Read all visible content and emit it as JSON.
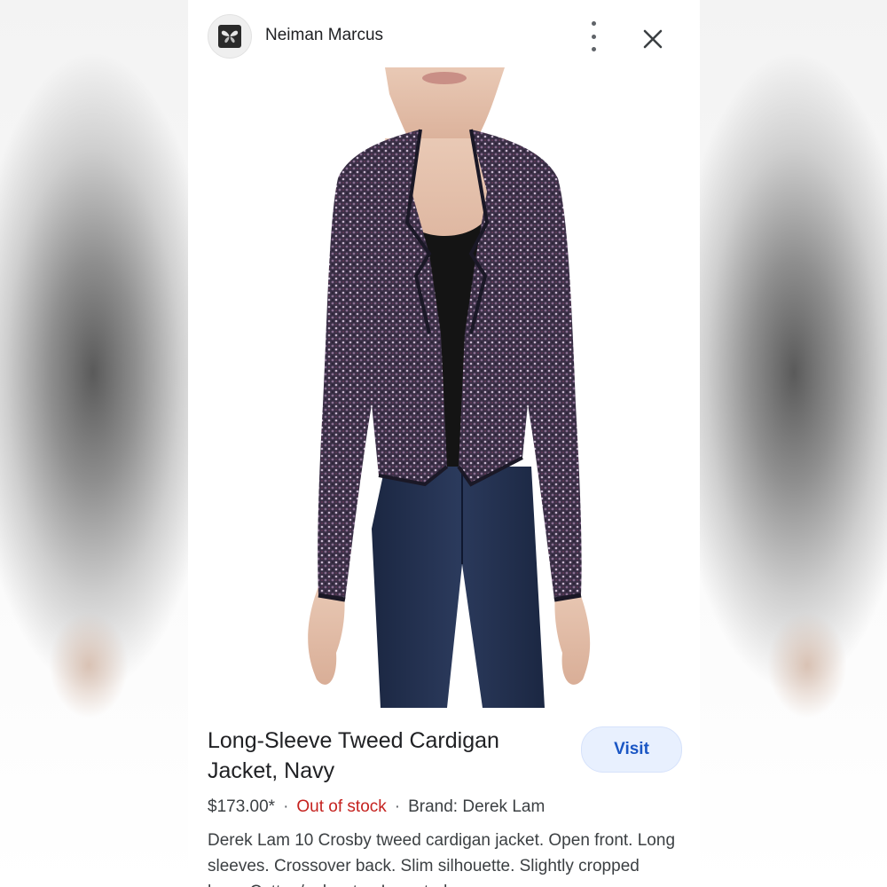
{
  "header": {
    "site_name": "Neiman Marcus",
    "logo_icon": "butterfly-icon",
    "more_icon": "more-vert-icon",
    "close_icon": "close-icon"
  },
  "product": {
    "image_alt": "Long-Sleeve Tweed Cardigan Jacket, Navy",
    "title": "Long-Sleeve Tweed Cardigan Jacket, Navy",
    "price": "$173.00*",
    "stock_status": "Out of stock",
    "brand": "Brand: Derek Lam",
    "separator": "·",
    "description": "Derek Lam 10 Crosby tweed cardigan jacket. Open front. Long sleeves. Crossover back. Slim silhouette. Slightly cropped hem. Cotton/polyester. Imported."
  },
  "actions": {
    "visit_label": "Visit"
  },
  "colors": {
    "accent": "#1a56c4",
    "visit_bg": "#e8f0fe",
    "out_of_stock": "#c5221f",
    "text": "#202124"
  }
}
